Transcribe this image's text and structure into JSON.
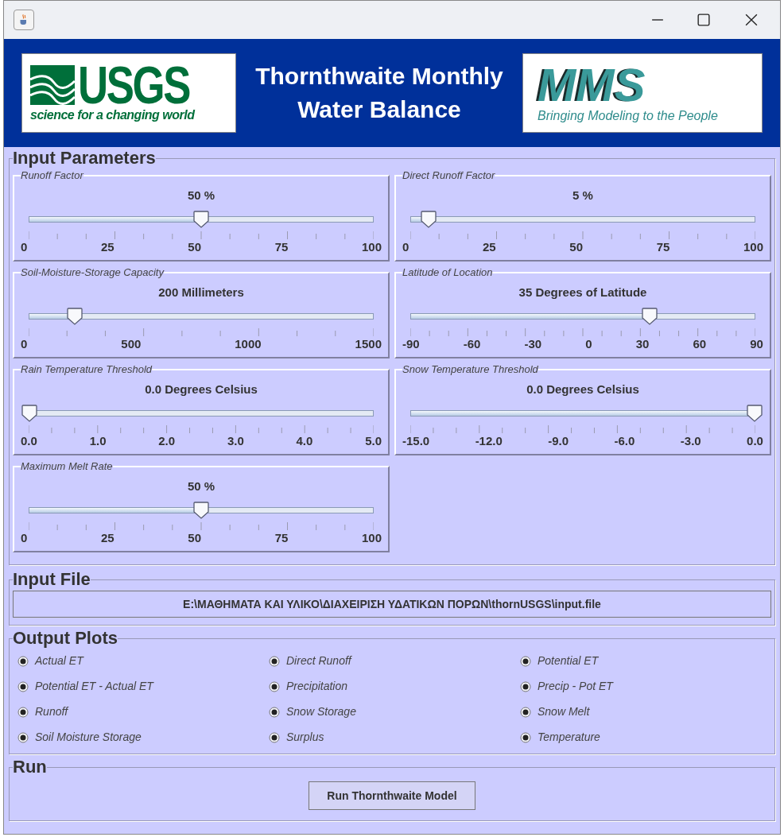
{
  "banner": {
    "title": "Thornthwaite Monthly Water Balance",
    "left_logo": {
      "name": "USGS",
      "tagline": "science for a changing world"
    },
    "right_logo": {
      "name": "MMS",
      "tagline": "Bringing Modeling to the People"
    }
  },
  "input_parameters": {
    "title": "Input Parameters",
    "sliders": [
      {
        "label": "Runoff Factor",
        "value": "50  %",
        "level": 0.5,
        "ticks": [
          "0",
          "25",
          "50",
          "75",
          "100"
        ]
      },
      {
        "label": "Direct Runoff Factor",
        "value": "5  %",
        "level": 0.05,
        "ticks": [
          "0",
          "25",
          "50",
          "75",
          "100"
        ]
      },
      {
        "label": "Soil-Moisture-Storage Capacity",
        "value": "200  Millimeters",
        "level": 0.133,
        "ticks": [
          "0",
          "500",
          "1000",
          "1500"
        ]
      },
      {
        "label": "Latitude of Location",
        "value": "35  Degrees of Latitude",
        "level": 0.694,
        "ticks": [
          "-90",
          "-60",
          "-30",
          "0",
          "30",
          "60",
          "90"
        ]
      },
      {
        "label": "Rain Temperature Threshold",
        "value": "0.0  Degrees Celsius",
        "level": 0,
        "ticks": [
          "0.0",
          "1.0",
          "2.0",
          "3.0",
          "4.0",
          "5.0"
        ]
      },
      {
        "label": "Snow Temperature Threshold",
        "value": "0.0  Degrees Celsius",
        "level": 1,
        "ticks": [
          "-15.0",
          "-12.0",
          "-9.0",
          "-6.0",
          "-3.0",
          "0.0"
        ]
      },
      {
        "label": "Maximum Melt Rate",
        "value": "50 %",
        "level": 0.5,
        "ticks": [
          "0",
          "25",
          "50",
          "75",
          "100"
        ]
      }
    ]
  },
  "input_file": {
    "title": "Input File",
    "path": "E:\\ΜΑΘΗΜΑΤΑ ΚΑΙ ΥΛΙΚΟ\\ΔΙΑΧΕΙΡΙΣΗ ΥΔΑΤΙΚΩΝ ΠΟΡΩΝ\\thornUSGS\\input.file"
  },
  "output_plots": {
    "title": "Output Plots",
    "options": [
      {
        "label": "Actual ET",
        "checked": true
      },
      {
        "label": "Direct Runoff",
        "checked": true
      },
      {
        "label": "Potential ET",
        "checked": true
      },
      {
        "label": "Potential ET - Actual ET",
        "checked": true
      },
      {
        "label": "Precipitation",
        "checked": true
      },
      {
        "label": "Precip - Pot ET",
        "checked": true
      },
      {
        "label": "Runoff",
        "checked": true
      },
      {
        "label": "Snow Storage",
        "checked": true
      },
      {
        "label": "Snow Melt",
        "checked": true
      },
      {
        "label": "Soil Moisture Storage",
        "checked": true
      },
      {
        "label": "Surplus",
        "checked": true
      },
      {
        "label": "Temperature",
        "checked": true
      }
    ]
  },
  "run": {
    "title": "Run",
    "button": "Run Thornthwaite Model"
  }
}
